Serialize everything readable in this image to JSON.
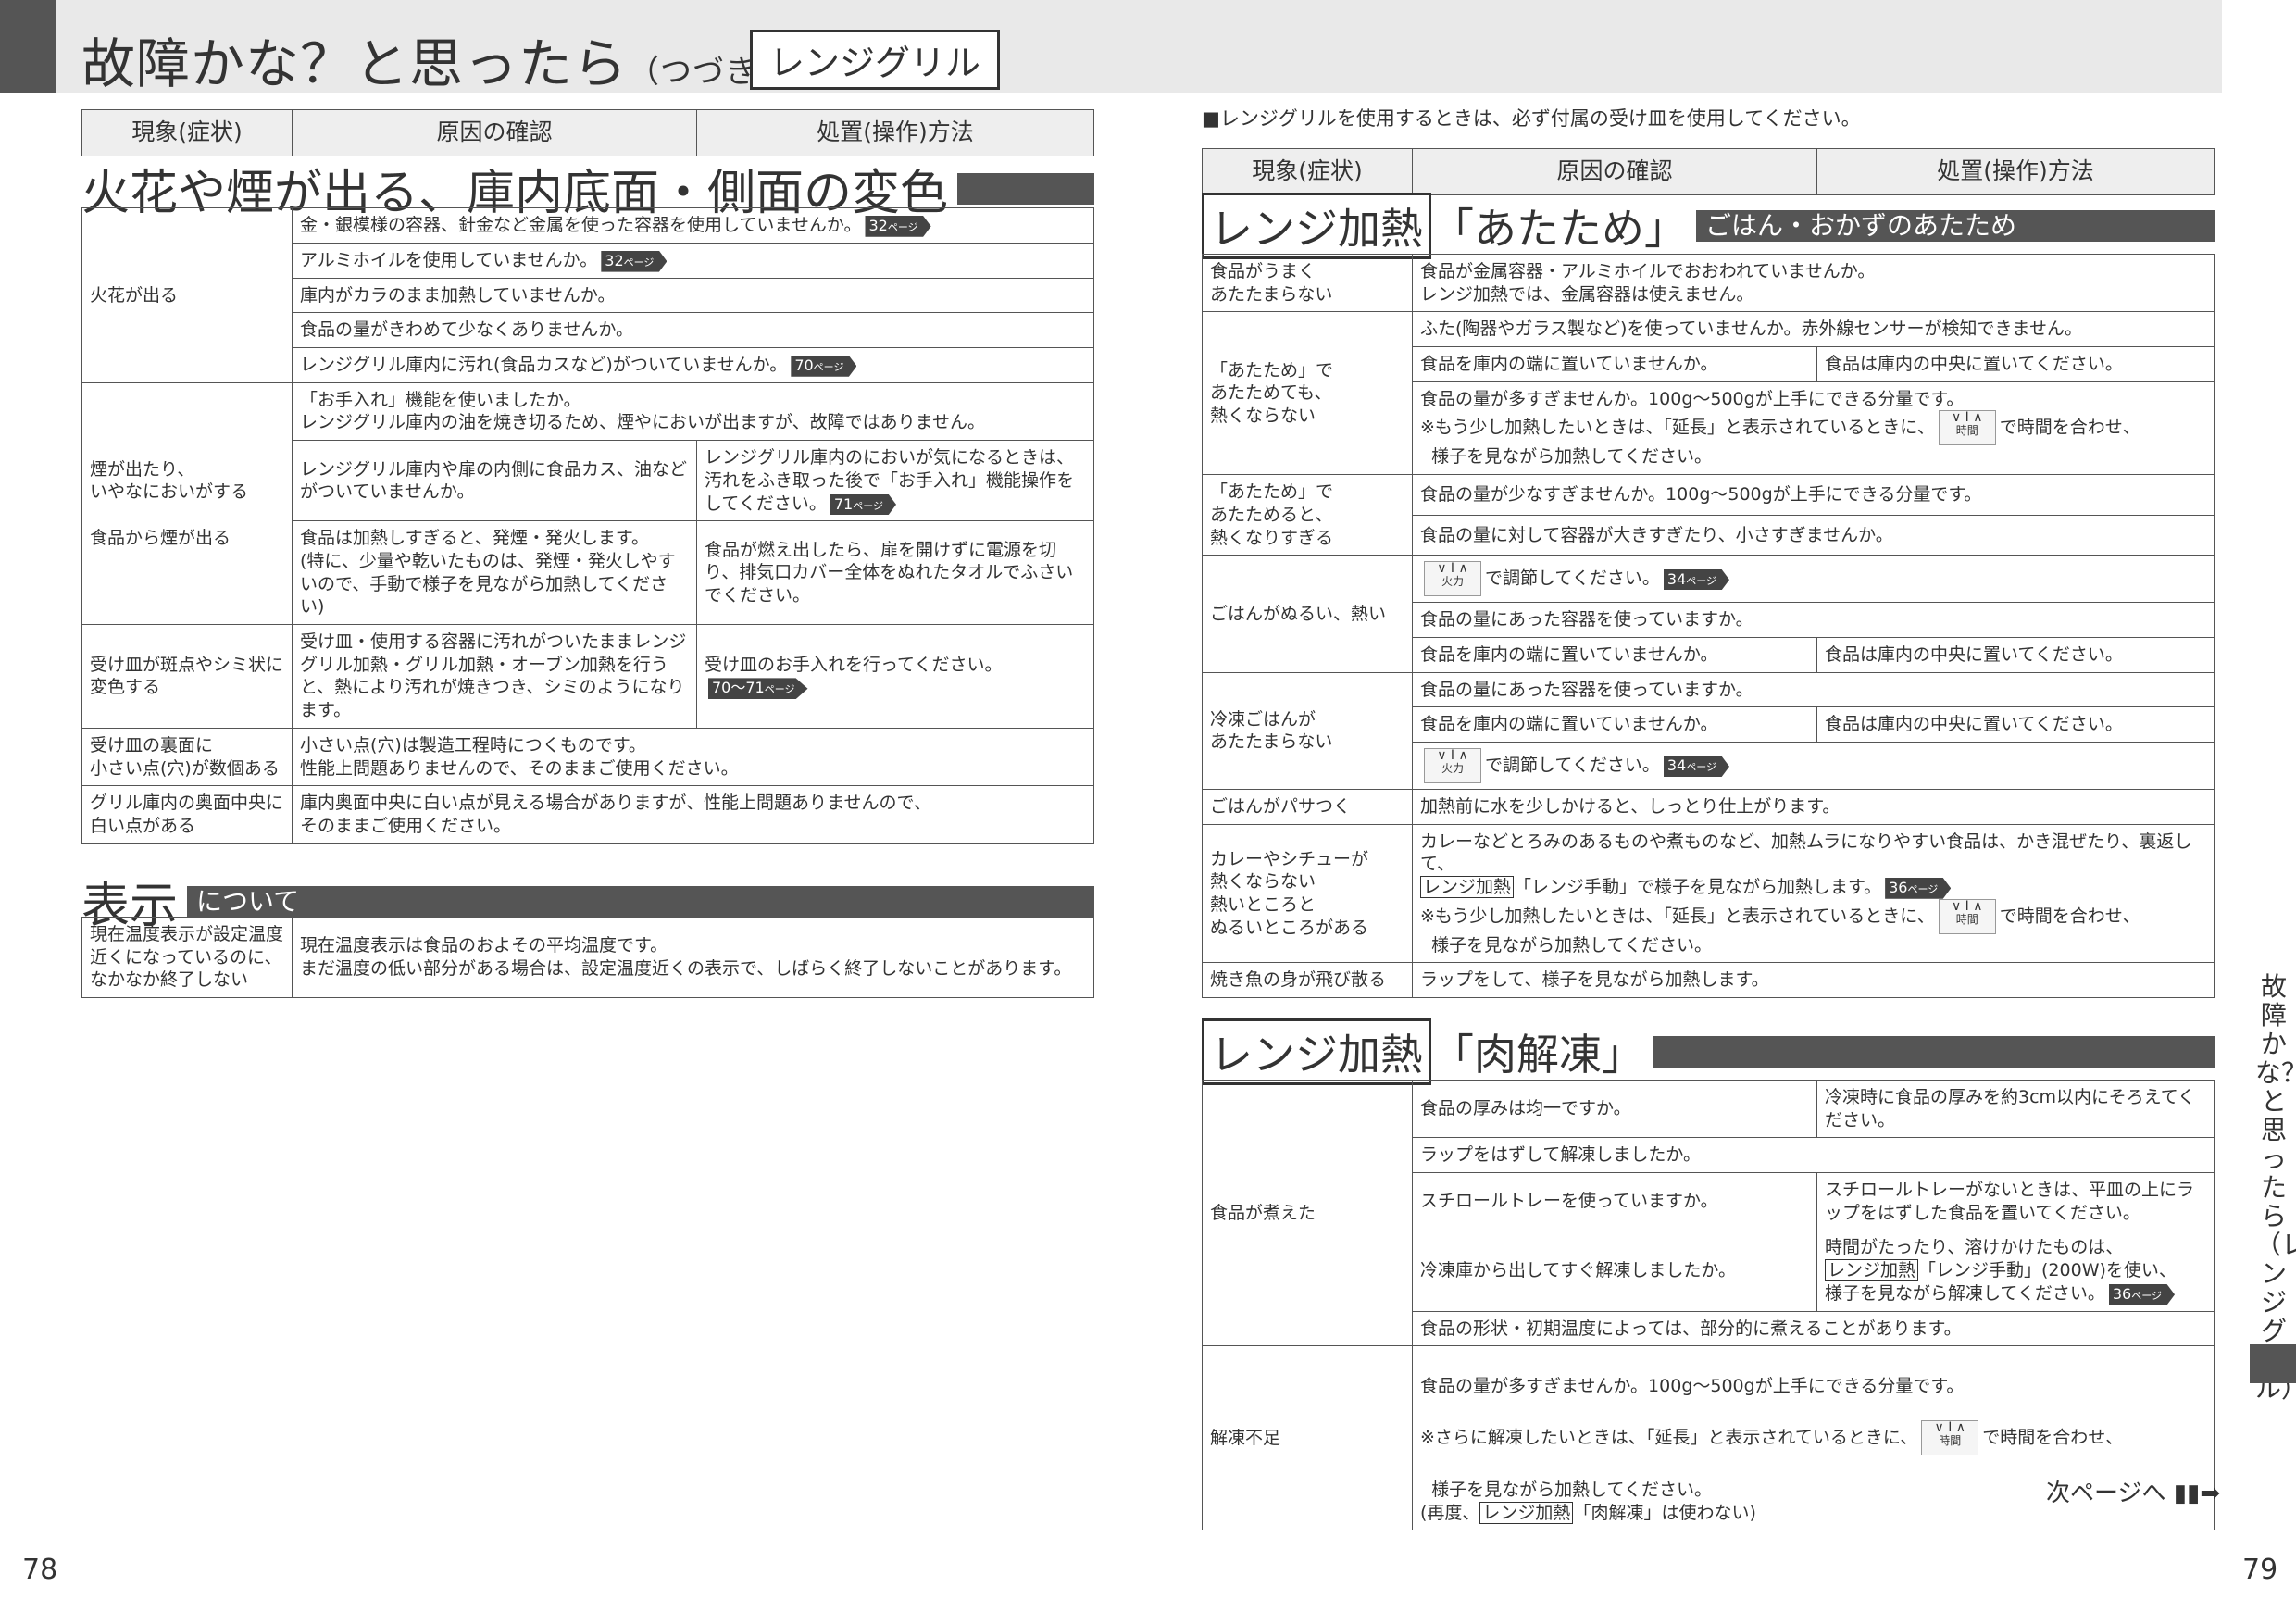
{
  "header": {
    "title": "故障かな？と思ったら",
    "title_sub": "（つづき）",
    "category": "レンジグリル"
  },
  "col_headers": {
    "symptom": "現象(症状)",
    "cause": "原因の確認",
    "remedy": "処置(操作)方法"
  },
  "sec1": {
    "title": "火花や煙が出る、庫内底面・側面の変色",
    "rows": {
      "r1": {
        "symptom": "火花が出る",
        "c1": "金・銀模様の容器、針金など金属を使った容器を使用していませんか。",
        "c1_ref": "32",
        "c2": "アルミホイルを使用していませんか。",
        "c2_ref": "32",
        "c3": "庫内がカラのまま加熱していませんか。",
        "c4": "食品の量がきわめて少なくありませんか。",
        "c5": "レンジグリル庫内に汚れ(食品カスなど)がついていませんか。",
        "c5_ref": "70"
      },
      "r2": {
        "symptom_a": "煙が出たり、\nいやなにおいがする",
        "symptom_b": "食品から煙が出る",
        "c1": "「お手入れ」機能を使いましたか。\nレンジグリル庫内の油を焼き切るため、煙やにおいが出ますが、故障ではありません。",
        "c2": "レンジグリル庫内や扉の内側に食品カス、油などがついていませんか。",
        "c2_fix": "レンジグリル庫内のにおいが気になるときは、汚れをふき取った後で「お手入れ」機能操作をしてください。",
        "c2_ref": "71",
        "c3": "食品は加熱しすぎると、発煙・発火します。\n(特に、少量や乾いたものは、発煙・発火しやすいので、手動で様子を見ながら加熱してください)",
        "c3_fix": "食品が燃え出したら、扉を開けずに電源を切り、排気口カバー全体をぬれたタオルでふさいでください。"
      },
      "r3": {
        "symptom": "受け皿が斑点やシミ状に変色する",
        "cause": "受け皿・使用する容器に汚れがついたままレンジグリル加熱・グリル加熱・オーブン加熱を行うと、熱により汚れが焼きつき、シミのようになります。",
        "fix": "受け皿のお手入れを行ってください。",
        "ref": "70〜71"
      },
      "r4": {
        "symptom": "受け皿の裏面に\n小さい点(穴)が数個ある",
        "cause": "小さい点(穴)は製造工程時につくものです。\n性能上問題ありませんので、そのままご使用ください。"
      },
      "r5": {
        "symptom": "グリル庫内の奥面中央に\n白い点がある",
        "cause": "庫内奥面中央に白い点が見える場合がありますが、性能上問題ありませんので、\nそのままご使用ください。"
      }
    }
  },
  "sec2": {
    "title_big": "表示",
    "title_bar": "について",
    "row": {
      "symptom": "現在温度表示が設定温度近くになっているのに、なかなか終了しない",
      "cause": "現在温度表示は食品のおよその平均温度です。\nまだ温度の低い部分がある場合は、設定温度近くの表示で、しばらく終了しないことがあります。"
    }
  },
  "right_note": "■レンジグリルを使用するときは、必ず付属の受け皿を使用してください。",
  "sec3": {
    "tag": "レンジ加熱",
    "title": "「あたため」",
    "bar": "ごはん・おかずのあたため",
    "rows": {
      "a": {
        "symptom": "食品がうまく\nあたたまらない",
        "cause": "食品が金属容器・アルミホイルでおおわれていませんか。\nレンジ加熱では、金属容器は使えません。"
      },
      "b": {
        "symptom": "「あたため」で\nあたためても、\n熱くならない",
        "c1": "ふた(陶器やガラス製など)を使っていませんか。赤外線センサーが検知できません。",
        "c2": "食品を庫内の端に置いていませんか。",
        "c2_fix": "食品は庫内の中央に置いてください。",
        "c3": "食品の量が多すぎませんか。100g〜500gが上手にできる分量です。",
        "c3_note_a": "※もう少し加熱したいときは、「延長」と表示されているときに、",
        "c3_note_b": "で時間を合わせ、",
        "c3_note_c": "様子を見ながら加熱してください。"
      },
      "c": {
        "symptom": "「あたため」で\nあたためると、\n熱くなりすぎる",
        "c1": "食品の量が少なすぎませんか。100g〜500gが上手にできる分量です。",
        "c2": "食品の量に対して容器が大きすぎたり、小さすぎませんか。"
      },
      "d": {
        "symptom": "ごはんがぬるい、熱い",
        "c1": "で調節してください。",
        "c1_ref": "34",
        "c2": "食品の量にあった容器を使っていますか。",
        "c3": "食品を庫内の端に置いていませんか。",
        "c3_fix": "食品は庫内の中央に置いてください。"
      },
      "e": {
        "symptom": "冷凍ごはんが\nあたたまらない",
        "c1": "食品の量にあった容器を使っていますか。",
        "c2": "食品を庫内の端に置いていませんか。",
        "c2_fix": "食品は庫内の中央に置いてください。",
        "c3": "で調節してください。",
        "c3_ref": "34"
      },
      "f": {
        "symptom": "ごはんがパサつく",
        "cause": "加熱前に水を少しかけると、しっとり仕上がります。"
      },
      "g": {
        "symptom": "カレーやシチューが\n熱くならない\n熱いところと\nぬるいところがある",
        "c1": "カレーなどとろみのあるものや煮ものなど、加熱ムラになりやすい食品は、かき混ぜたり、裏返して、",
        "c1_tag": "レンジ加熱",
        "c1_b": "「レンジ手動」で様子を見ながら加熱します。",
        "c1_ref": "36",
        "c1_note_a": "※もう少し加熱したいときは、「延長」と表示されているときに、",
        "c1_note_b": "で時間を合わせ、",
        "c1_note_c": "様子を見ながら加熱してください。"
      },
      "h": {
        "symptom": "焼き魚の身が飛び散る",
        "cause": "ラップをして、様子を見ながら加熱します。"
      }
    }
  },
  "sec4": {
    "tag": "レンジ加熱",
    "title": "「肉解凍」",
    "rows": {
      "a": {
        "symptom": "食品が煮えた",
        "c1": "食品の厚みは均一ですか。",
        "c1_fix": "冷凍時に食品の厚みを約3cm以内にそろえてください。",
        "c2": "ラップをはずして解凍しましたか。",
        "c3": "スチロールトレーを使っていますか。",
        "c3_fix": "スチロールトレーがないときは、平皿の上にラップをはずした食品を置いてください。",
        "c4": "冷凍庫から出してすぐ解凍しましたか。",
        "c4_fix_a": "時間がたったり、溶けかけたものは、",
        "c4_tag": "レンジ加熱",
        "c4_fix_b": "「レンジ手動」(200W)を使い、\n様子を見ながら解凍してください。",
        "c4_ref": "36",
        "c5": "食品の形状・初期温度によっては、部分的に煮えることがあります。"
      },
      "b": {
        "symptom": "解凍不足",
        "c1": "食品の量が多すぎませんか。100g〜500gが上手にできる分量です。",
        "note_a": "※さらに解凍したいときは、「延長」と表示されているときに、",
        "note_b": "で時間を合わせ、",
        "note_c": "様子を見ながら加熱してください。\n(再度、",
        "note_tag": "レンジ加熱",
        "note_d": "「肉解凍」は使わない)"
      }
    }
  },
  "dial": {
    "time": "時間",
    "power": "火力"
  },
  "ref_suffix": "ページ",
  "side_label": "故障かな？と思ったら（レンジグリル）",
  "next_page": "次ページへ",
  "page_left": "78",
  "page_right": "79"
}
